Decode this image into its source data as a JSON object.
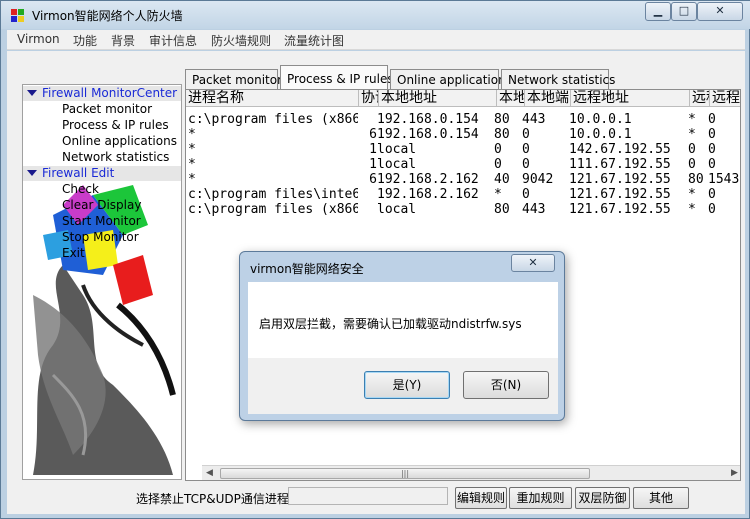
{
  "window": {
    "title": "Virmon智能网络个人防火墙",
    "minimize": "▁",
    "maximize": "□",
    "close": "✕"
  },
  "menu": [
    "Virmon",
    "功能",
    "背景",
    "审计信息",
    "防火墙规则",
    "流量统计图"
  ],
  "sidebar": {
    "categories": [
      {
        "label": "Firewall MonitorCenter",
        "items": [
          "Packet monitor",
          "Process & IP rules",
          "Online applications",
          "Network statistics"
        ]
      },
      {
        "label": "Firewall Edit",
        "items": [
          "Check",
          "Clear Display",
          "Start Monitor",
          "Stop Monitor",
          "Exit"
        ]
      }
    ]
  },
  "tabs": [
    {
      "label": "Packet monitor"
    },
    {
      "label": "Process & IP rules"
    },
    {
      "label": "Online applications"
    },
    {
      "label": "Network statistics"
    }
  ],
  "active_tab": "Process & IP rules",
  "table": {
    "columns": [
      "进程名称",
      "协议",
      "本地地址",
      "本地端口",
      "本地端口",
      "远程地址",
      "远程",
      "远程"
    ],
    "rows": [
      [
        "c:\\program files (x866",
        "",
        "192.168.0.154",
        "80",
        "443",
        "10.0.0.1",
        "*",
        "0"
      ],
      [
        "*",
        "6",
        "192.168.0.154",
        "80",
        "0",
        "10.0.0.1",
        "*",
        "0"
      ],
      [
        "*",
        "1",
        "local",
        "0",
        "0",
        "142.67.192.55",
        "0",
        "0"
      ],
      [
        "*",
        "1",
        "local",
        "0",
        "0",
        "111.67.192.55",
        "0",
        "0"
      ],
      [
        "*",
        "6",
        "192.168.2.162",
        "40",
        "9042",
        "121.67.192.55",
        "80",
        "1543"
      ],
      [
        "c:\\program files\\inte6",
        "",
        "192.168.2.162",
        "*",
        "0",
        "121.67.192.55",
        "*",
        "0"
      ],
      [
        "c:\\program files (x866",
        "",
        "local",
        "80",
        "443",
        "121.67.192.55",
        "*",
        "0"
      ]
    ]
  },
  "scroll_thumb_grip": "|||",
  "bottom": {
    "label": "选择禁止TCP&UDP通信进程",
    "input_value": "",
    "buttons": [
      "编辑规则",
      "重加规则",
      "双层防御",
      "其他"
    ]
  },
  "dialog": {
    "title": "virmon智能网络安全",
    "close": "✕",
    "message": "启用双层拦截，需要确认已加载驱动ndistrfw.sys",
    "yes": "是(Y)",
    "no": "否(N)"
  }
}
